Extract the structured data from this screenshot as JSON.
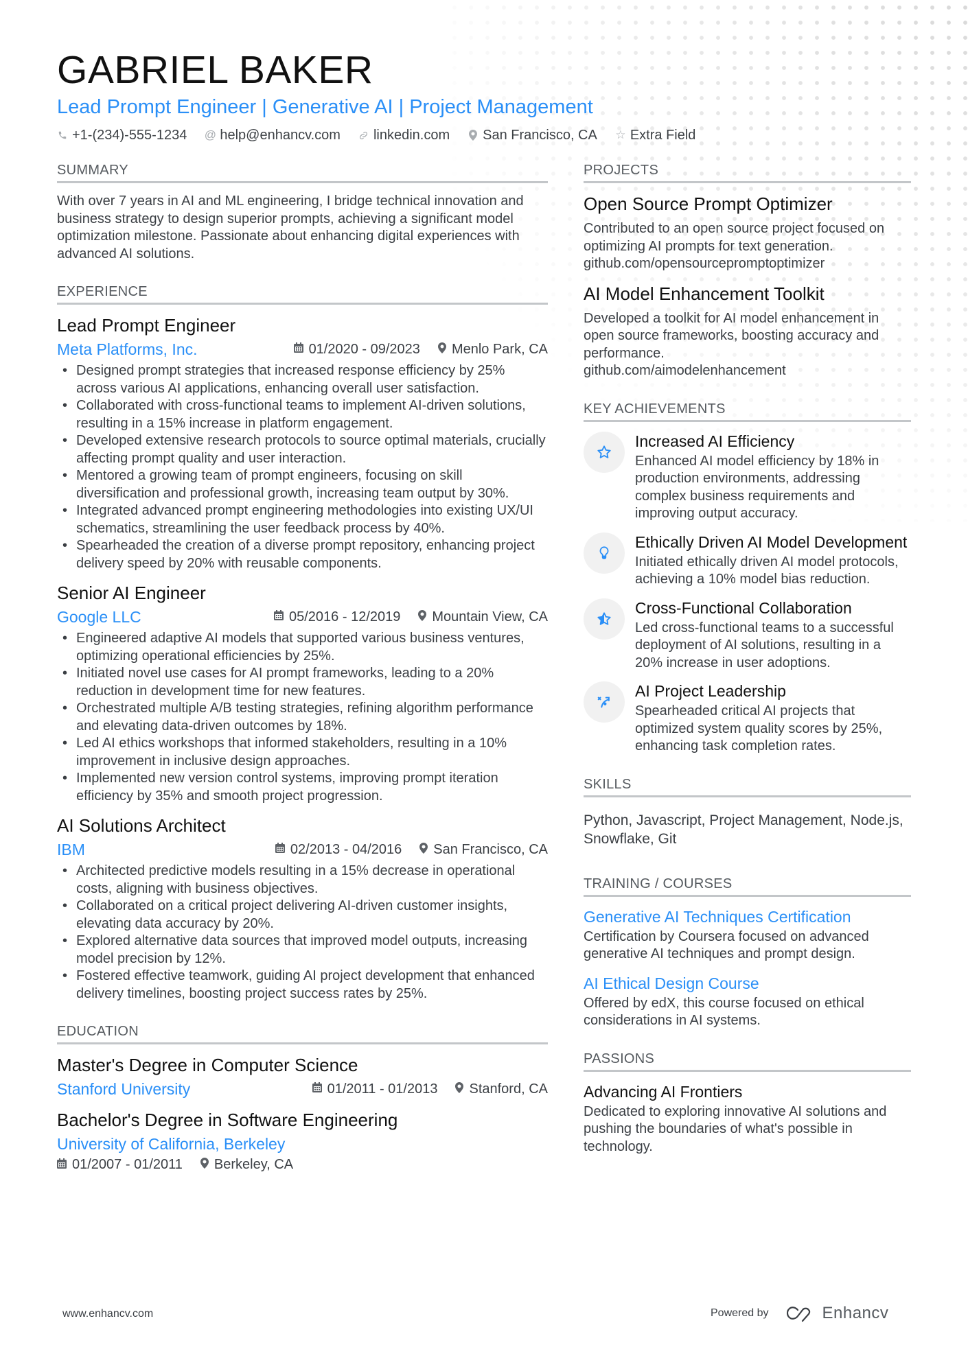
{
  "header": {
    "name": "GABRIEL BAKER",
    "subtitle": "Lead Prompt Engineer | Generative AI | Project Management",
    "contacts": [
      {
        "icon": "phone-icon",
        "text": "+1-(234)-555-1234"
      },
      {
        "icon": "at-icon",
        "text": "help@enhancv.com"
      },
      {
        "icon": "link-icon",
        "text": "linkedin.com"
      },
      {
        "icon": "location-icon",
        "text": "San Francisco, CA"
      },
      {
        "icon": "star-icon",
        "text": "Extra Field"
      }
    ]
  },
  "summary": {
    "title": "SUMMARY",
    "text": "With over 7 years in AI and ML engineering, I bridge technical innovation and business strategy to design superior prompts, achieving a significant model optimization milestone. Passionate about enhancing digital experiences with advanced AI solutions."
  },
  "experience": {
    "title": "EXPERIENCE",
    "jobs": [
      {
        "title": "Lead Prompt Engineer",
        "company": "Meta Platforms, Inc.",
        "dates": "01/2020 - 09/2023",
        "location": "Menlo Park, CA",
        "bullets": [
          "Designed prompt strategies that increased response efficiency by 25% across various AI applications, enhancing overall user satisfaction.",
          "Collaborated with cross-functional teams to implement AI-driven solutions, resulting in a 15% increase in platform engagement.",
          "Developed extensive research protocols to source optimal materials, crucially affecting prompt quality and user interaction.",
          "Mentored a growing team of prompt engineers, focusing on skill diversification and professional growth, increasing team output by 30%.",
          "Integrated advanced prompt engineering methodologies into existing UX/UI schematics, streamlining the user feedback process by 40%.",
          "Spearheaded the creation of a diverse prompt repository, enhancing project delivery speed by 20% with reusable components."
        ]
      },
      {
        "title": "Senior AI Engineer",
        "company": "Google LLC",
        "dates": "05/2016 - 12/2019",
        "location": "Mountain View, CA",
        "bullets": [
          "Engineered adaptive AI models that supported various business ventures, optimizing operational efficiencies by 25%.",
          "Initiated novel use cases for AI prompt frameworks, leading to a 20% reduction in development time for new features.",
          "Orchestrated multiple A/B testing strategies, refining algorithm performance and elevating data-driven outcomes by 18%.",
          "Led AI ethics workshops that informed stakeholders, resulting in a 10% improvement in inclusive design approaches.",
          "Implemented new version control systems, improving prompt iteration efficiency by 35% and smooth project progression."
        ]
      },
      {
        "title": "AI Solutions Architect",
        "company": "IBM",
        "dates": "02/2013 - 04/2016",
        "location": "San Francisco, CA",
        "bullets": [
          "Architected predictive models resulting in a 15% decrease in operational costs, aligning with business objectives.",
          "Collaborated on a critical project delivering AI-driven customer insights, elevating data accuracy by 20%.",
          "Explored alternative data sources that improved model outputs, increasing model precision by 12%.",
          "Fostered effective teamwork, guiding AI project development that enhanced delivery timelines, boosting project success rates by 25%."
        ]
      }
    ]
  },
  "education": {
    "title": "EDUCATION",
    "items": [
      {
        "degree": "Master's Degree in Computer Science",
        "school": "Stanford University",
        "dates": "01/2011 - 01/2013",
        "location": "Stanford, CA"
      },
      {
        "degree": "Bachelor's Degree in Software Engineering",
        "school": "University of California, Berkeley",
        "dates": "01/2007 - 01/2011",
        "location": "Berkeley, CA"
      }
    ]
  },
  "projects": {
    "title": "PROJECTS",
    "items": [
      {
        "title": "Open Source Prompt Optimizer",
        "description": "Contributed to an open source project focused on optimizing AI prompts for text generation.",
        "link": "github.com/opensourcepromptoptimizer"
      },
      {
        "title": "AI Model Enhancement Toolkit",
        "description": "Developed a toolkit for AI model enhancement in open source frameworks, boosting accuracy and performance.",
        "link": "github.com/aimodelenhancement"
      }
    ]
  },
  "achievements": {
    "title": "KEY ACHIEVEMENTS",
    "items": [
      {
        "icon": "star-outline-icon",
        "title": "Increased AI Efficiency",
        "description": "Enhanced AI model efficiency by 18% in production environments, addressing complex business requirements and improving output accuracy."
      },
      {
        "icon": "lightbulb-icon",
        "title": "Ethically Driven AI Model Development",
        "description": "Initiated ethically driven AI model protocols, achieving a 10% model bias reduction."
      },
      {
        "icon": "star-half-icon",
        "title": "Cross-Functional Collaboration",
        "description": "Led cross-functional teams to a successful deployment of AI solutions, resulting in a 20% increase in user adoptions."
      },
      {
        "icon": "strategy-icon",
        "title": "AI Project Leadership",
        "description": "Spearheaded critical AI projects that optimized system quality scores by 25%, enhancing task completion rates."
      }
    ]
  },
  "skills": {
    "title": "SKILLS",
    "text": "Python, Javascript, Project Management, Node.js, Snowflake, Git"
  },
  "training": {
    "title": "TRAINING / COURSES",
    "items": [
      {
        "title": "Generative AI Techniques Certification",
        "description": "Certification by Coursera focused on advanced generative AI techniques and prompt design."
      },
      {
        "title": "AI Ethical Design Course",
        "description": "Offered by edX, this course focused on ethical considerations in AI systems."
      }
    ]
  },
  "passions": {
    "title": "PASSIONS",
    "items": [
      {
        "title": "Advancing AI Frontiers",
        "description": "Dedicated to exploring innovative AI solutions and pushing the boundaries of what's possible in technology."
      }
    ]
  },
  "footer": {
    "website": "www.enhancv.com",
    "powered_by": "Powered by",
    "brand": "Enhancv"
  },
  "colors": {
    "accent": "#2a8ff7",
    "text": "#3b3f44",
    "heading": "#111111",
    "rule": "#c3c6c9"
  }
}
